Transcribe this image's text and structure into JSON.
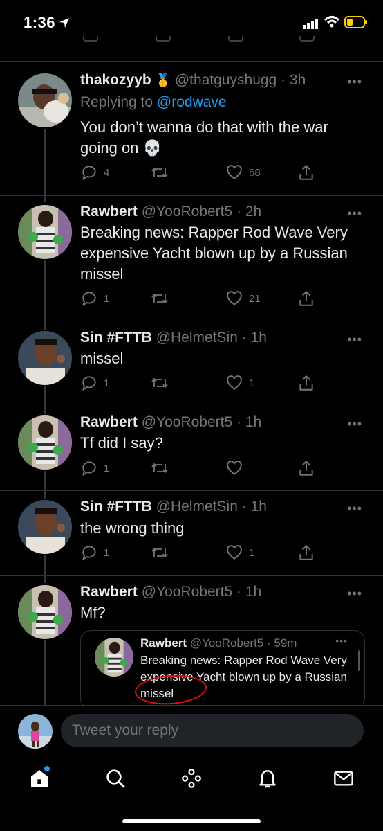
{
  "status_bar": {
    "time": "1:36"
  },
  "tweets": [
    {
      "name": "thakozyyb",
      "badge": "🥇",
      "handle": "@thatguyshugg",
      "time": "3h",
      "replying_prefix": "Replying to",
      "replying_to": "@rodwave",
      "text": "You don’t wanna do that with the war going on 💀",
      "replies": "4",
      "retweets": "",
      "likes": "68"
    },
    {
      "name": "Rawbert",
      "handle": "@YooRobert5",
      "time": "2h",
      "text": "Breaking news: Rapper Rod Wave Very expensive Yacht blown up by a Russian missel",
      "replies": "1",
      "retweets": "",
      "likes": "21"
    },
    {
      "name": "Sin #FTTB",
      "handle": "@HelmetSin",
      "time": "1h",
      "text": "missel",
      "replies": "1",
      "retweets": "",
      "likes": "1"
    },
    {
      "name": "Rawbert",
      "handle": "@YooRobert5",
      "time": "1h",
      "text": "Tf did I say?",
      "replies": "1",
      "retweets": "",
      "likes": ""
    },
    {
      "name": "Sin #FTTB",
      "handle": "@HelmetSin",
      "time": "1h",
      "text": "the wrong thing",
      "replies": "1",
      "retweets": "",
      "likes": "1"
    },
    {
      "name": "Rawbert",
      "handle": "@YooRobert5",
      "time": "1h",
      "text": "Mf?"
    }
  ],
  "quoted_tweet": {
    "name": "Rawbert",
    "handle": "@YooRobert5",
    "time": "59m",
    "text_before": "Breaking news: Rapper Rod Wave Very expensive Yacht blown up by a Russian",
    "text_circled": "missel"
  },
  "reply_bar": {
    "placeholder": "Tweet your reply"
  },
  "separator": "·",
  "icons": {
    "reply": "reply-icon",
    "retweet": "retweet-icon",
    "like": "heart-icon",
    "share": "share-icon",
    "more": "more-icon",
    "home": "home-icon",
    "search": "search-icon",
    "spaces": "spaces-icon",
    "notifications": "bell-icon",
    "messages": "mail-icon"
  },
  "colors": {
    "background": "#000000",
    "accent": "#1d9bf0",
    "muted": "#71767b",
    "text": "#e7e9ea",
    "annotation": "#dd1111"
  }
}
